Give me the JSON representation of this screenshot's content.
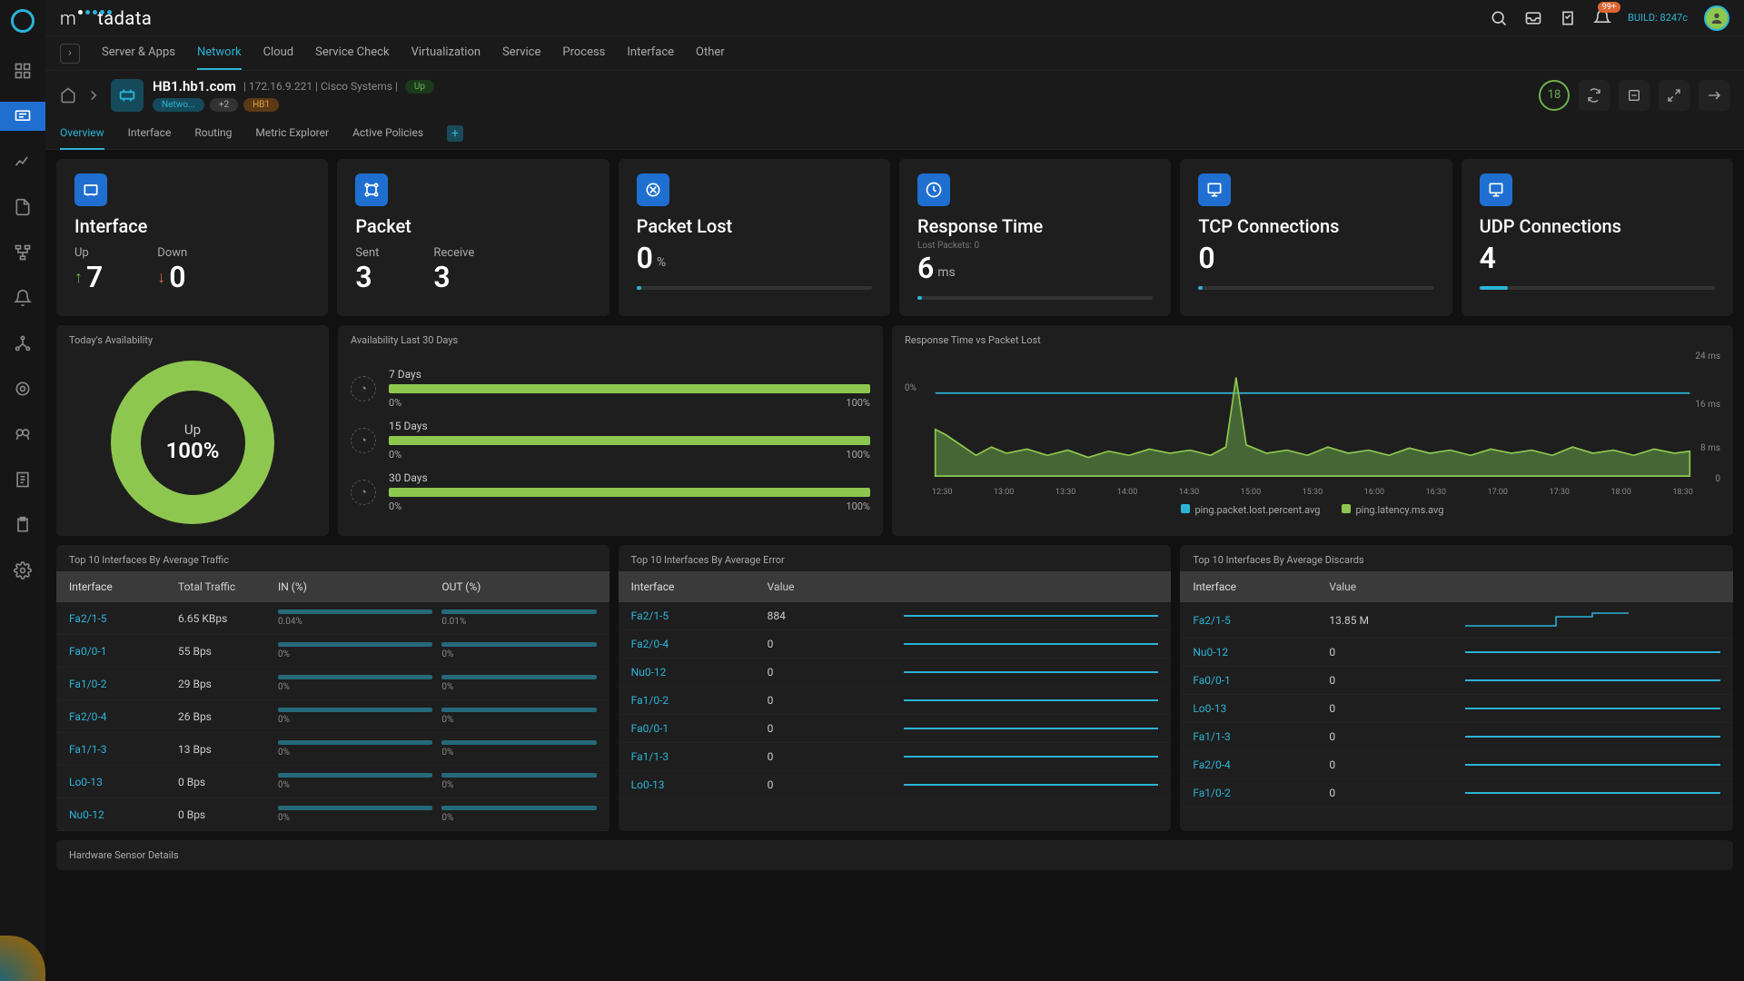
{
  "brand": {
    "name": "motadata",
    "build": "BUILD: 8247c",
    "notif_badge": "99+"
  },
  "topnav": [
    "Server & Apps",
    "Network",
    "Cloud",
    "Service Check",
    "Virtualization",
    "Service",
    "Process",
    "Interface",
    "Other"
  ],
  "topnav_active": "Network",
  "device": {
    "name": "HB1.hb1.com",
    "ip": "172.16.9.221",
    "vendor": "Cisco Systems",
    "status": "Up",
    "tags": {
      "netwo": "Netwo...",
      "plus": "+2",
      "hb": "HB1"
    },
    "count": "18"
  },
  "subtabs": [
    "Overview",
    "Interface",
    "Routing",
    "Metric Explorer",
    "Active Policies"
  ],
  "subtab_active": "Overview",
  "stats": {
    "interface": {
      "title": "Interface",
      "up_label": "Up",
      "up": "7",
      "down_label": "Down",
      "down": "0"
    },
    "packet": {
      "title": "Packet",
      "sent_label": "Sent",
      "sent": "3",
      "recv_label": "Receive",
      "recv": "3"
    },
    "packet_lost": {
      "title": "Packet Lost",
      "value": "0",
      "unit": "%"
    },
    "response": {
      "title": "Response Time",
      "sub": "Lost Packets: 0",
      "value": "6",
      "unit": "ms"
    },
    "tcp": {
      "title": "TCP Connections",
      "value": "0"
    },
    "udp": {
      "title": "UDP Connections",
      "value": "4"
    }
  },
  "availability": {
    "today_title": "Today's Availability",
    "donut_label": "Up",
    "donut_pct": "100%",
    "last30_title": "Availability Last 30 Days",
    "rows": [
      {
        "label": "7 Days",
        "min": "0%",
        "max": "100%"
      },
      {
        "label": "15 Days",
        "min": "0%",
        "max": "100%"
      },
      {
        "label": "30 Days",
        "min": "0%",
        "max": "100%"
      }
    ]
  },
  "rt": {
    "title": "Response Time vs Packet Lost",
    "ylabels": [
      "24 ms",
      "16 ms",
      "8 ms",
      "0"
    ],
    "leftlabel": "0%",
    "xlabels": [
      "12:30",
      "13:00",
      "13:30",
      "14:00",
      "14:30",
      "15:00",
      "15:30",
      "16:00",
      "16:30",
      "17:00",
      "17:30",
      "18:00",
      "18:30"
    ],
    "legend": [
      "ping.packet.lost.percent.avg",
      "ping.latency.ms.avg"
    ]
  },
  "chart_data": {
    "type": "line",
    "title": "Response Time vs Packet Lost",
    "x": [
      "12:30",
      "13:00",
      "13:30",
      "14:00",
      "14:30",
      "15:00",
      "15:30",
      "16:00",
      "16:30",
      "17:00",
      "17:30",
      "18:00",
      "18:30"
    ],
    "series": [
      {
        "name": "ping.packet.lost.percent.avg",
        "unit": "%",
        "values": [
          0,
          0,
          0,
          0,
          0,
          0,
          0,
          0,
          0,
          0,
          0,
          0,
          0
        ]
      },
      {
        "name": "ping.latency.ms.avg",
        "unit": "ms",
        "values": [
          8,
          7,
          6,
          7,
          6,
          22,
          6,
          7,
          6,
          6,
          7,
          6,
          7
        ]
      }
    ],
    "y_right": {
      "min": 0,
      "max": 24,
      "unit": "ms"
    },
    "y_left": {
      "min": 0,
      "max": 100,
      "unit": "%"
    }
  },
  "traffic": {
    "title": "Top 10 Interfaces By Average Traffic",
    "headers": [
      "Interface",
      "Total Traffic",
      "IN (%)",
      "OUT (%)"
    ],
    "rows": [
      {
        "iface": "Fa2/1-5",
        "total": "6.65 KBps",
        "in": "0.04%",
        "out": "0.01%"
      },
      {
        "iface": "Fa0/0-1",
        "total": "55 Bps",
        "in": "0%",
        "out": "0%"
      },
      {
        "iface": "Fa1/0-2",
        "total": "29 Bps",
        "in": "0%",
        "out": "0%"
      },
      {
        "iface": "Fa2/0-4",
        "total": "26 Bps",
        "in": "0%",
        "out": "0%"
      },
      {
        "iface": "Fa1/1-3",
        "total": "13 Bps",
        "in": "0%",
        "out": "0%"
      },
      {
        "iface": "Lo0-13",
        "total": "0 Bps",
        "in": "0%",
        "out": "0%"
      },
      {
        "iface": "Nu0-12",
        "total": "0 Bps",
        "in": "0%",
        "out": "0%"
      }
    ]
  },
  "errors": {
    "title": "Top 10 Interfaces By Average Error",
    "headers": [
      "Interface",
      "Value"
    ],
    "rows": [
      {
        "iface": "Fa2/1-5",
        "val": "884"
      },
      {
        "iface": "Fa2/0-4",
        "val": "0"
      },
      {
        "iface": "Nu0-12",
        "val": "0"
      },
      {
        "iface": "Fa1/0-2",
        "val": "0"
      },
      {
        "iface": "Fa0/0-1",
        "val": "0"
      },
      {
        "iface": "Fa1/1-3",
        "val": "0"
      },
      {
        "iface": "Lo0-13",
        "val": "0"
      }
    ]
  },
  "discards": {
    "title": "Top 10 Interfaces By Average Discards",
    "headers": [
      "Interface",
      "Value"
    ],
    "rows": [
      {
        "iface": "Fa2/1-5",
        "val": "13.85 M",
        "step": true
      },
      {
        "iface": "Nu0-12",
        "val": "0"
      },
      {
        "iface": "Fa0/0-1",
        "val": "0"
      },
      {
        "iface": "Lo0-13",
        "val": "0"
      },
      {
        "iface": "Fa1/1-3",
        "val": "0"
      },
      {
        "iface": "Fa2/0-4",
        "val": "0"
      },
      {
        "iface": "Fa1/0-2",
        "val": "0"
      }
    ]
  },
  "hw_title": "Hardware Sensor Details"
}
